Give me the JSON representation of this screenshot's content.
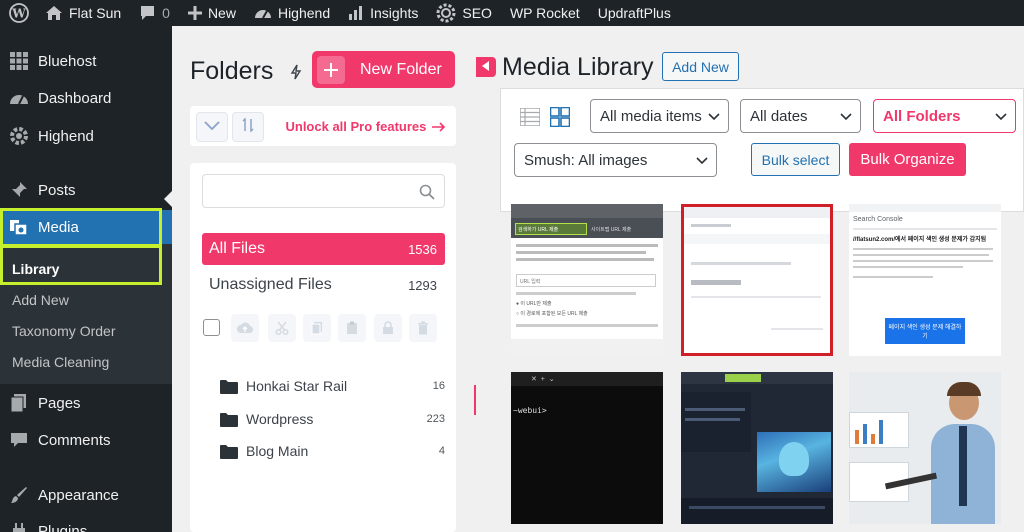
{
  "adminbar": {
    "site_name": "Flat Sun",
    "comments_count": "0",
    "new_label": "New",
    "highend_label": "Highend",
    "insights_label": "Insights",
    "seo_label": "SEO",
    "wprocket_label": "WP Rocket",
    "updraft_label": "UpdraftPlus"
  },
  "sidebar": {
    "items": [
      {
        "label": "Bluehost",
        "icon": "grid-icon"
      },
      {
        "label": "Dashboard",
        "icon": "gauge-icon"
      },
      {
        "label": "Highend",
        "icon": "gear-icon"
      },
      {
        "label": "Posts",
        "icon": "pin-icon"
      },
      {
        "label": "Media",
        "icon": "media-icon"
      },
      {
        "label": "Pages",
        "icon": "page-icon"
      },
      {
        "label": "Comments",
        "icon": "comment-icon"
      },
      {
        "label": "Appearance",
        "icon": "brush-icon"
      },
      {
        "label": "Plugins",
        "icon": "plugin-icon"
      }
    ],
    "submenu": [
      "Library",
      "Add New",
      "Taxonomy Order",
      "Media Cleaning"
    ],
    "active": "Media",
    "current_sub": "Library"
  },
  "folders": {
    "title": "Folders",
    "new_folder_label": "New Folder",
    "unlock_label": "Unlock all Pro features",
    "all_files_label": "All Files",
    "all_files_count": "1536",
    "unassigned_label": "Unassigned Files",
    "unassigned_count": "1293",
    "list": [
      {
        "name": "Honkai Star Rail",
        "count": "16"
      },
      {
        "name": "Wordpress",
        "count": "223"
      },
      {
        "name": "Blog Main",
        "count": "4"
      }
    ]
  },
  "media": {
    "title": "Media Library",
    "add_new_label": "Add New",
    "filter_media": "All media items",
    "filter_dates": "All dates",
    "filter_folders": "All Folders",
    "filter_smush": "Smush: All images",
    "bulk_select_label": "Bulk select",
    "bulk_organize_label": "Bulk Organize"
  },
  "thumbnails": {
    "t1": {
      "tab1": "검색하기 URL 제출",
      "tab2": "사이트맵 URL 제출",
      "field": "URL 입력",
      "opt1": "이 URL만 제출",
      "opt2": "이 경로에 포함된 모든 URL 제출"
    },
    "t3": {
      "brand": "Search Console",
      "url": "//flatsun2.com/에서 페이지 색인 생성 문제가 감지됨",
      "button": "페이지 색인 생성 문제 해결하기"
    },
    "t4": {
      "prompt": "~webui>"
    }
  },
  "colors": {
    "accent": "#f0386b",
    "wp_blue": "#2271b1",
    "admin_dark": "#1d2327",
    "highlight": "#c6f02e"
  }
}
